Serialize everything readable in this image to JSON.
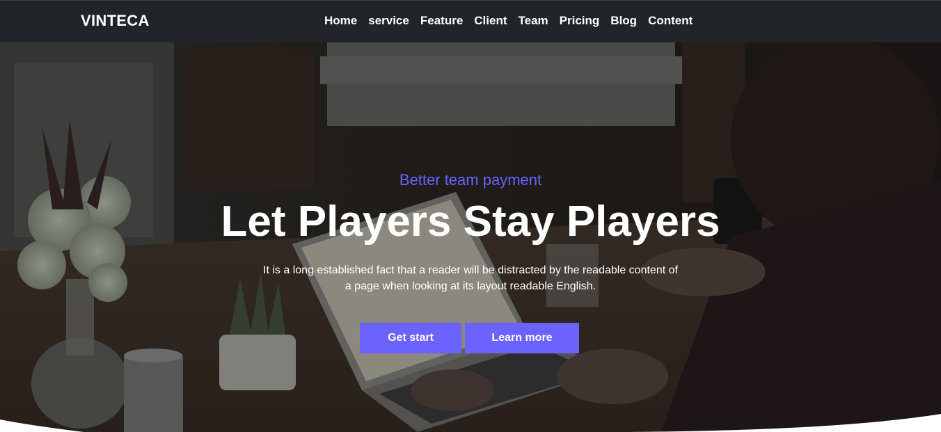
{
  "navbar": {
    "brand": "VINTECA",
    "links": [
      "Home",
      "service",
      "Feature",
      "Client",
      "Team",
      "Pricing",
      "Blog",
      "Content"
    ]
  },
  "hero": {
    "eyebrow": "Better team payment",
    "headline": "Let Players Stay Players",
    "lede": "It is a long established fact that a reader will be distracted by the readable content of a page when looking at its layout readable English.",
    "buttons": {
      "primary": "Get start",
      "secondary": "Learn more"
    }
  },
  "colors": {
    "navbar_bg": "#212529",
    "accent": "#6c63ff",
    "text_light": "#ffffff"
  }
}
